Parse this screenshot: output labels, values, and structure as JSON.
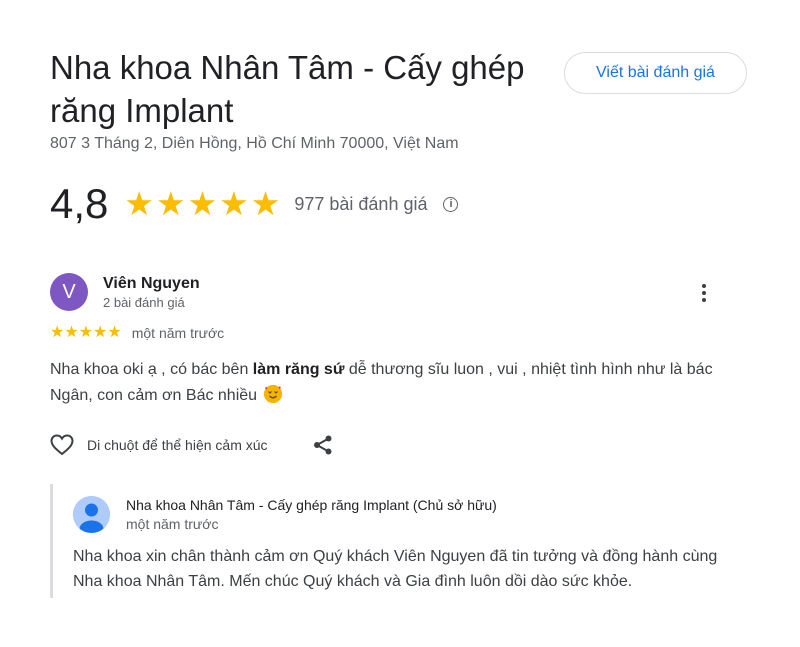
{
  "place": {
    "title": "Nha khoa Nhân Tâm - Cấy ghép răng Implant",
    "address": "807 3 Tháng 2, Diên Hồng, Hồ Chí Minh 70000, Việt Nam",
    "rating": "4,8",
    "rating_value": 4.8,
    "stars": 5,
    "review_count": "977 bài đánh giá",
    "write_review_label": "Viết bài đánh giá"
  },
  "review": {
    "avatar_letter": "V",
    "avatar_color": "#7e57c2",
    "reviewer_name": "Viên Nguyen",
    "reviewer_meta": "2 bài đánh giá",
    "stars": 5,
    "time": "một năm trước",
    "text_before": "Nha khoa oki ạ , có bác bên ",
    "text_bold": "làm răng sứ",
    "text_after": " dễ thương sĩu luon , vui , nhiệt tình hình như là bác Ngân, con cảm ơn Bác nhiều",
    "emoji": "smiling-face-with-hearts",
    "react_label": "Di chuột để thể hiện cảm xúc"
  },
  "reply": {
    "owner_name": "Nha khoa Nhân Tâm - Cấy ghép răng Implant (Chủ sở hữu)",
    "time": "một năm trước",
    "text": "Nha khoa xin chân thành cảm ơn Quý khách Viên Nguyen đã tin tưởng và đồng hành cùng Nha khoa Nhân Tâm. Mến chúc Quý khách và Gia đình luôn dồi dào sức khỏe."
  },
  "colors": {
    "star": "#fbbc04",
    "link": "#1a73e8",
    "secondary_text": "#5f6368"
  },
  "icons": [
    "star-icon",
    "info-icon",
    "more-vert-icon",
    "heart-icon",
    "share-icon",
    "owner-avatar-icon"
  ]
}
